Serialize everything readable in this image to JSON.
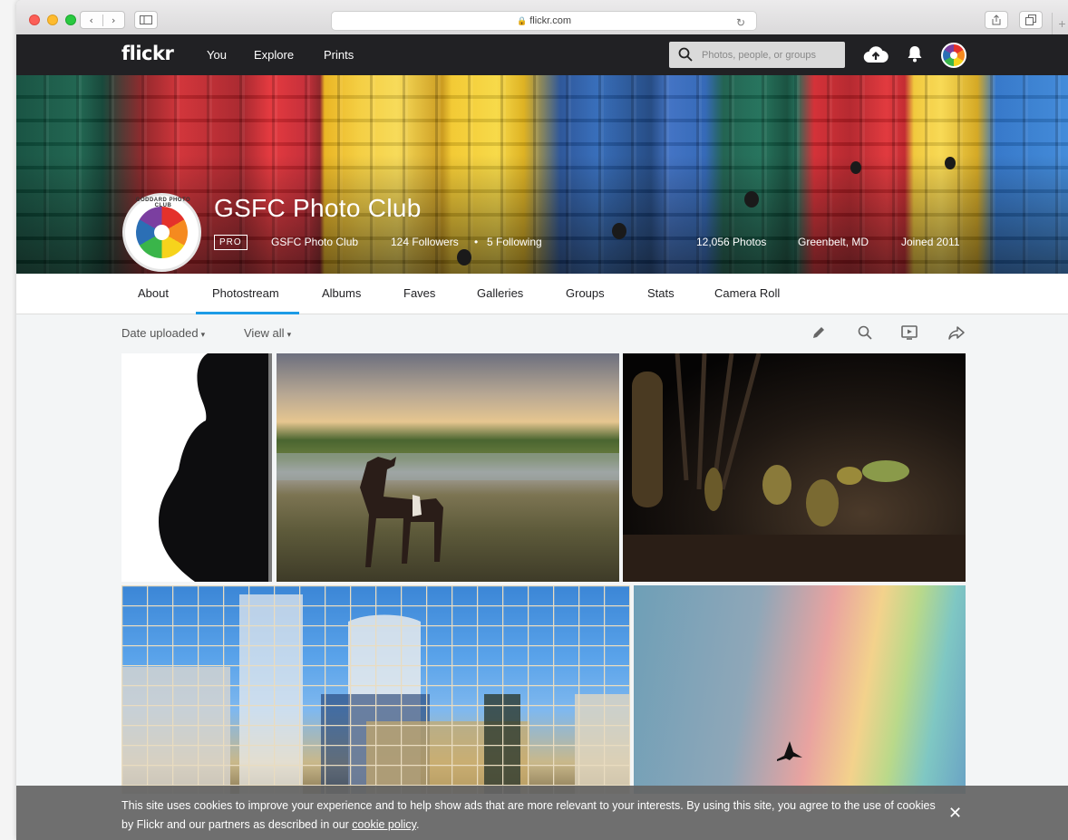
{
  "browser": {
    "url": "flickr.com",
    "reload_glyph": "↻",
    "back_glyph": "‹",
    "forward_glyph": "›",
    "plus_glyph": "+"
  },
  "nav": {
    "logo": "flickr",
    "links": [
      "You",
      "Explore",
      "Prints"
    ],
    "search_placeholder": "Photos, people, or groups"
  },
  "profile": {
    "name": "GSFC Photo Club",
    "badge": "PRO",
    "username": "GSFC Photo Club",
    "followers": "124 Followers",
    "separator": "•",
    "following": "5 Following",
    "photos": "12,056 Photos",
    "location": "Greenbelt, MD",
    "joined": "Joined 2011",
    "logo_text": "GODDARD PHOTO CLUB"
  },
  "tabs": [
    {
      "label": "About",
      "active": false
    },
    {
      "label": "Photostream",
      "active": true
    },
    {
      "label": "Albums",
      "active": false
    },
    {
      "label": "Faves",
      "active": false
    },
    {
      "label": "Galleries",
      "active": false
    },
    {
      "label": "Groups",
      "active": false
    },
    {
      "label": "Stats",
      "active": false
    },
    {
      "label": "Camera Roll",
      "active": false
    }
  ],
  "toolbar": {
    "sort": "Date uploaded",
    "view": "View all",
    "caret": "▾"
  },
  "photos": [
    {
      "subject": "pregnant-silhouette-photo"
    },
    {
      "subject": "dog-in-marsh-photo"
    },
    {
      "subject": "cactus-at-night-photo"
    },
    {
      "subject": "building-reflection-photo"
    },
    {
      "subject": "bird-rainbow-photo"
    }
  ],
  "cookie": {
    "text": "This site uses cookies to improve your experience and to help show ads that are more relevant to your interests. By using this site, you agree to the use of cookies by Flickr and our partners as described in our ",
    "link": "cookie policy",
    "end": ".",
    "close": "✕"
  },
  "colors": {
    "nav_bg": "#212124",
    "accent": "#1c9be6",
    "cookie_bg": "#646464"
  }
}
